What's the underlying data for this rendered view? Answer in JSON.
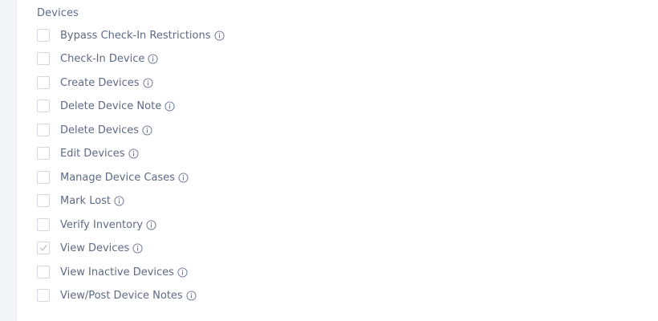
{
  "section": {
    "title": "Devices"
  },
  "icons": {
    "check": "checkmark-icon",
    "info": "info-icon"
  },
  "colors": {
    "text": "#5d6a84",
    "checkbox_border": "#d3d6de",
    "check_mark": "#b9bec8"
  },
  "permissions": [
    {
      "label": "Bypass Check-In Restrictions",
      "checked": false
    },
    {
      "label": "Check-In Device",
      "checked": false
    },
    {
      "label": "Create Devices",
      "checked": false
    },
    {
      "label": "Delete Device Note",
      "checked": false
    },
    {
      "label": "Delete Devices",
      "checked": false
    },
    {
      "label": "Edit Devices",
      "checked": false
    },
    {
      "label": "Manage Device Cases",
      "checked": false
    },
    {
      "label": "Mark Lost",
      "checked": false
    },
    {
      "label": "Verify Inventory",
      "checked": false
    },
    {
      "label": "View Devices",
      "checked": true
    },
    {
      "label": "View Inactive Devices",
      "checked": false
    },
    {
      "label": "View/Post Device Notes",
      "checked": false
    }
  ]
}
